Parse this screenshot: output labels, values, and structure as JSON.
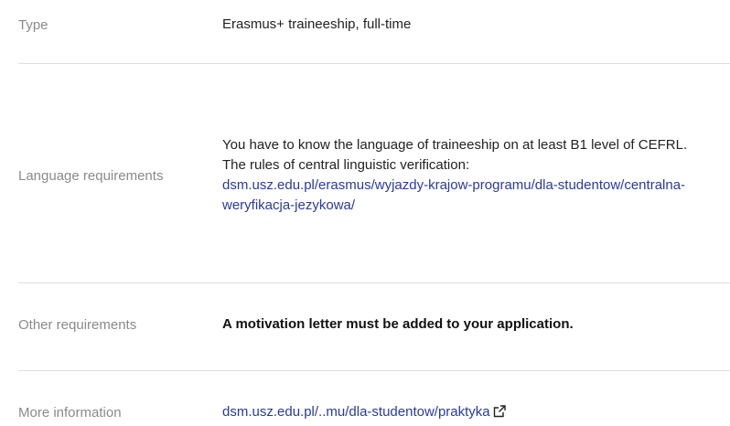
{
  "rows": {
    "type": {
      "label": "Type",
      "value": "Erasmus+ traineeship, full-time"
    },
    "language": {
      "label": "Language requirements",
      "line1": "You have to know the language of traineeship on at least B1 level of CEFRL.",
      "line2": "The rules of central linguistic verification:",
      "link": "dsm.usz.edu.pl/erasmus/wyjazdy-krajow-programu/dla-studentow/centralna-weryfikacja-jezykowa/"
    },
    "other": {
      "label": "Other requirements",
      "value": "A motivation letter must be added to your application."
    },
    "more": {
      "label": "More information",
      "link": "dsm.usz.edu.pl/..mu/dla-studentow/praktyka",
      "icon": "external-link-icon"
    }
  },
  "colors": {
    "label": "#8a8a8a",
    "text": "#222222",
    "link": "#2b3a9c",
    "divider": "#dedede"
  }
}
